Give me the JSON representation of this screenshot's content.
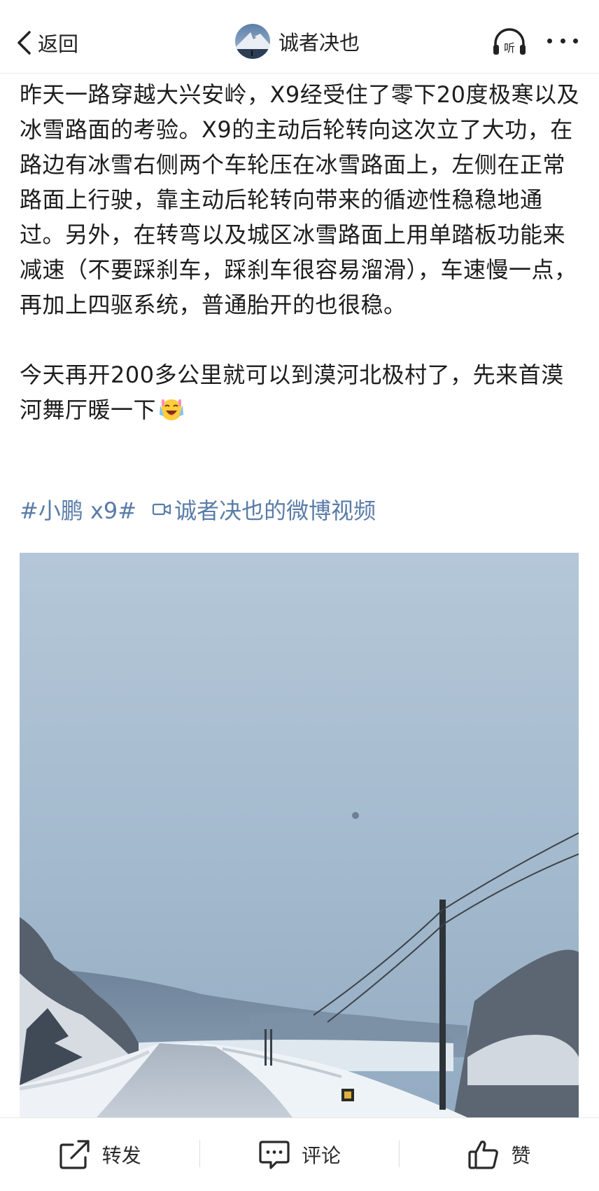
{
  "header": {
    "back_label": "返回",
    "username": "诚者决也",
    "listen_icon_text": "听"
  },
  "post": {
    "paragraph1": "昨天一路穿越大兴安岭，X9经受住了零下20度极寒以及冰雪路面的考验。X9的主动后轮转向这次立了大功，在路边有冰雪右侧两个车轮压在冰雪路面上，左侧在正常路面上行驶，靠主动后轮转向带来的循迹性稳稳地通过。另外，在转弯以及城区冰雪路面上用单踏板功能来减速（不要踩刹车，踩刹车很容易溜滑），车速慢一点，再加上四驱系统，普通胎开的也很稳。",
    "paragraph2": "今天再开200多公里就可以到漠河北极村了，先来首漠河舞厅暖一下",
    "emoji": "laughing-crying-emoji",
    "topic_tag": "#小鹏 x9#",
    "video_link": "诚者决也的微博视频"
  },
  "actions": {
    "repost_label": "转发",
    "comment_label": "评论",
    "like_label": "赞"
  },
  "colors": {
    "link": "#5a7ca8",
    "text": "#1d1d1d",
    "sky": "#9fb7cc"
  }
}
